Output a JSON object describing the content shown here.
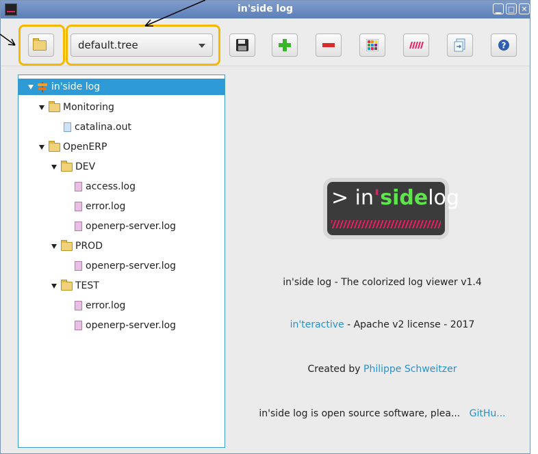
{
  "window": {
    "title": "in'side log",
    "controls": {
      "minimize": "▁",
      "maximize": "□",
      "close": "✕"
    }
  },
  "toolbar": {
    "tree_select_value": "default.tree",
    "buttons": [
      "open-folder",
      "save",
      "add",
      "remove",
      "colors",
      "highlight",
      "export",
      "help"
    ]
  },
  "tree": {
    "root": "in'side log",
    "items": [
      {
        "label": "Monitoring",
        "type": "folder",
        "depth": 1
      },
      {
        "label": "catalina.out",
        "type": "file-blue",
        "depth": 2
      },
      {
        "label": "OpenERP",
        "type": "folder",
        "depth": 1
      },
      {
        "label": "DEV",
        "type": "folder",
        "depth": 2
      },
      {
        "label": "access.log",
        "type": "file-pink",
        "depth": 3
      },
      {
        "label": "error.log",
        "type": "file-pink",
        "depth": 3
      },
      {
        "label": "openerp-server.log",
        "type": "file-pink",
        "depth": 3
      },
      {
        "label": "PROD",
        "type": "folder",
        "depth": 2
      },
      {
        "label": "openerp-server.log",
        "type": "file-pink",
        "depth": 3
      },
      {
        "label": "TEST",
        "type": "folder",
        "depth": 2
      },
      {
        "label": "error.log",
        "type": "file-pink",
        "depth": 3
      },
      {
        "label": "openerp-server.log",
        "type": "file-pink",
        "depth": 3
      }
    ]
  },
  "about": {
    "logo_arrow": ">",
    "logo_in": " in",
    "logo_apostrophe": "'",
    "logo_side": "side",
    "logo_log": "log",
    "tagline": "in'side log - The colorized log viewer v1.4",
    "license_link": "in'teractive",
    "license_text": " - Apache v2 license - 2017",
    "created_by": "Created by ",
    "author_link": "Philippe Schweitzer",
    "open_source_text": "in'side log is open source software, plea...",
    "github_link": "GitHu..."
  },
  "colors": {
    "accent": "#2e9bd6",
    "highlight": "#f5b800",
    "link": "#2a90c8"
  }
}
